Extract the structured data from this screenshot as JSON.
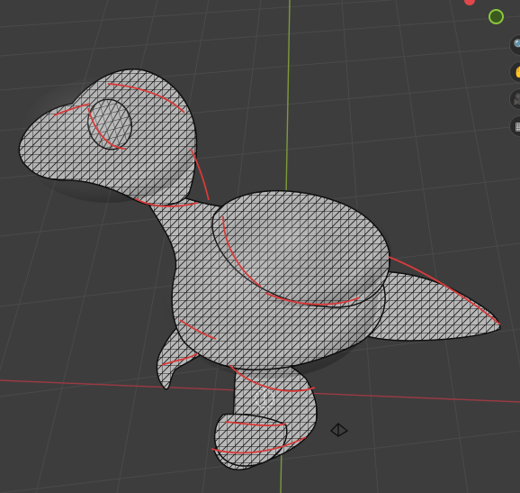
{
  "viewport": {
    "background": "#3d3d3d",
    "grid_color": "#4a4a4a",
    "x_axis_color": "#9b3a44",
    "y_axis_color": "#7e9a3a"
  },
  "mesh": {
    "object": "dinosaur-sculpt",
    "fill_color": "#bdbdbd",
    "wire_color": "#1b1b1b",
    "seam_color": "#d83a3a",
    "display": "wireframe-overlay"
  },
  "gizmo": {
    "y_axis_color": "#8cc63f",
    "x_axis_color": "#e0474c",
    "buttons": [
      {
        "name": "zoom-icon",
        "glyph": "🔍"
      },
      {
        "name": "pan-icon",
        "glyph": "✋"
      },
      {
        "name": "camera-icon",
        "glyph": "🎥"
      },
      {
        "name": "perspective-icon",
        "glyph": "▦"
      }
    ]
  },
  "scene_objects": {
    "camera_marker": "camera-icon",
    "origin_marker": "3d-cursor-icon"
  }
}
